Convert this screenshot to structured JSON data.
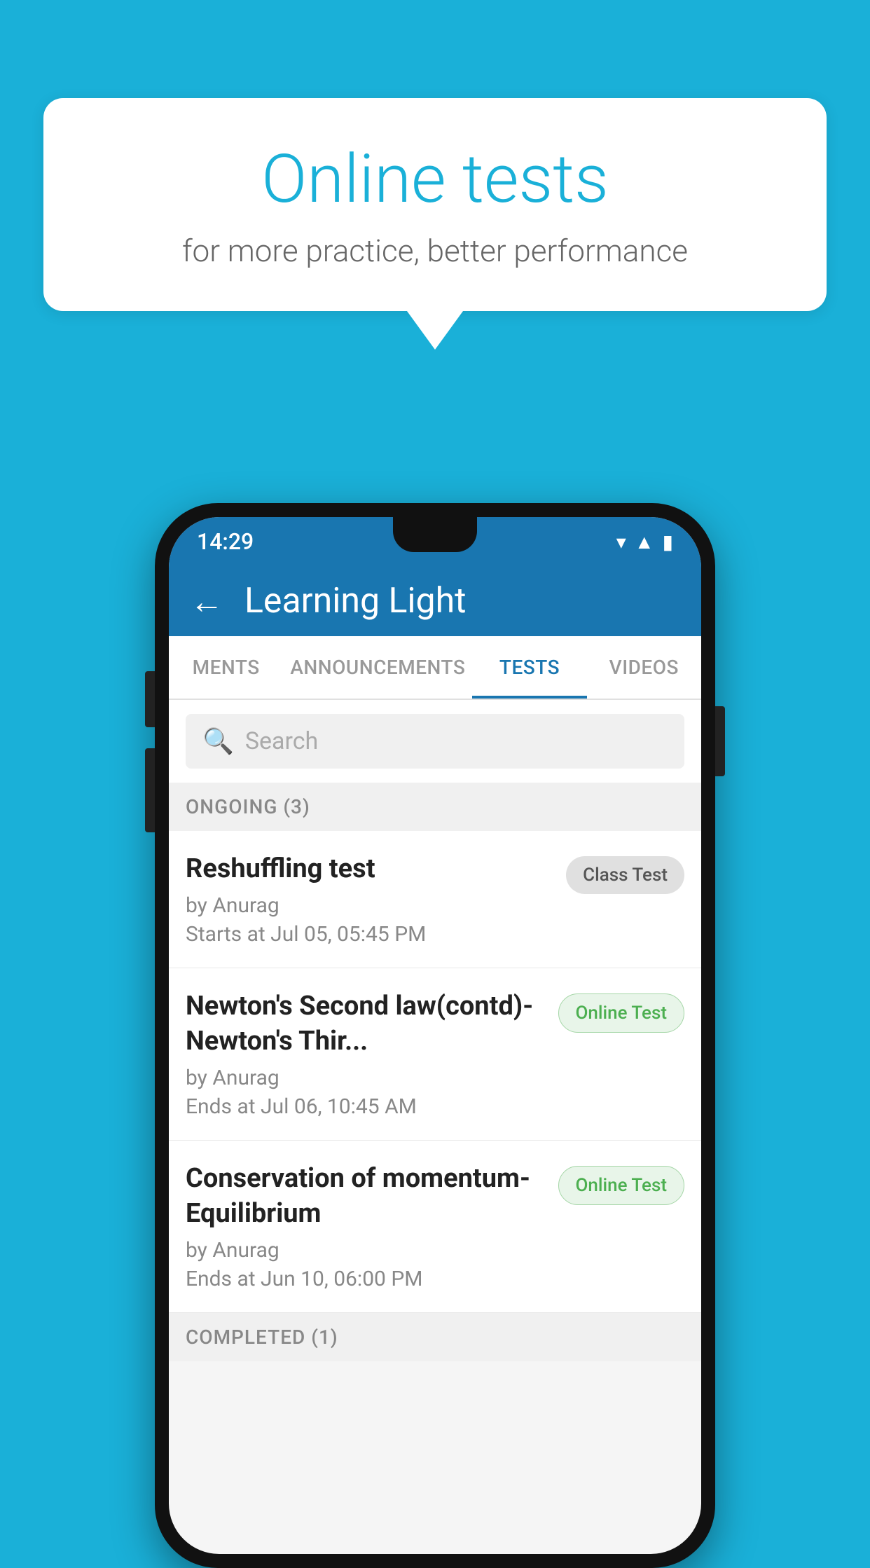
{
  "background_color": "#1ab0d8",
  "bubble": {
    "title": "Online tests",
    "subtitle": "for more practice, better performance"
  },
  "status_bar": {
    "time": "14:29",
    "icons": [
      "wifi",
      "signal",
      "battery"
    ]
  },
  "app_bar": {
    "title": "Learning Light",
    "back_label": "←"
  },
  "tabs": [
    {
      "label": "MENTS",
      "active": false
    },
    {
      "label": "ANNOUNCEMENTS",
      "active": false
    },
    {
      "label": "TESTS",
      "active": true
    },
    {
      "label": "VIDEOS",
      "active": false
    }
  ],
  "search": {
    "placeholder": "Search"
  },
  "ongoing_section": {
    "label": "ONGOING (3)"
  },
  "tests": [
    {
      "title": "Reshuffling test",
      "author": "by Anurag",
      "date": "Starts at  Jul 05, 05:45 PM",
      "badge": "Class Test",
      "badge_type": "class"
    },
    {
      "title": "Newton's Second law(contd)-Newton's Thir...",
      "author": "by Anurag",
      "date": "Ends at  Jul 06, 10:45 AM",
      "badge": "Online Test",
      "badge_type": "online"
    },
    {
      "title": "Conservation of momentum-Equilibrium",
      "author": "by Anurag",
      "date": "Ends at  Jun 10, 06:00 PM",
      "badge": "Online Test",
      "badge_type": "online"
    }
  ],
  "completed_section": {
    "label": "COMPLETED (1)"
  }
}
